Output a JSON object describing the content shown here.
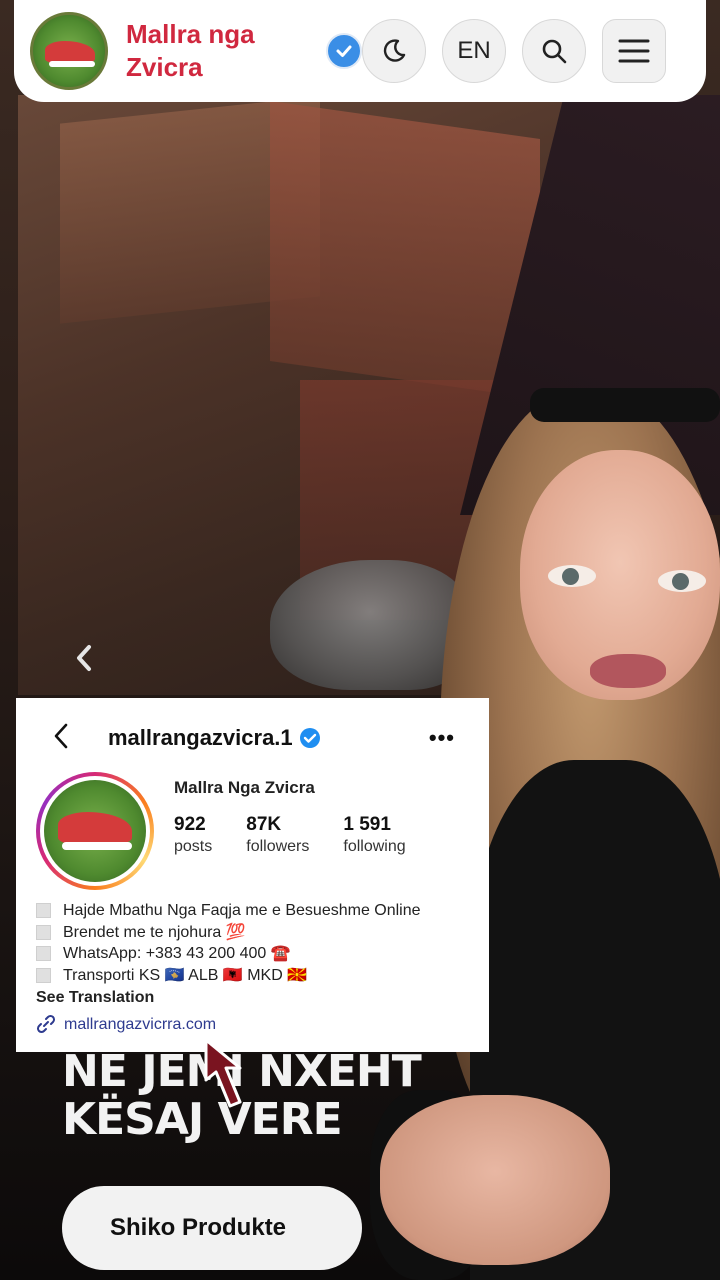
{
  "header": {
    "brand": "Mallra nga Zvicra",
    "brand_line1": "Mallra nga",
    "brand_line2": "Zvicra",
    "lang_label": "EN",
    "icons": [
      "verified-check-icon",
      "moon-icon",
      "search-icon",
      "menu-icon"
    ],
    "accent": "#d0283f"
  },
  "instagram": {
    "username": "mallrangazvicra.1",
    "display_name": "Mallra Nga Zvicra",
    "stats": [
      {
        "value": "922",
        "label": "posts"
      },
      {
        "value": "87K",
        "label": "followers"
      },
      {
        "value": "1 591",
        "label": "following"
      }
    ],
    "bio": [
      "Hajde Mbathu Nga Faqja me e Besueshme Online",
      "Brendet me te njohura 💯",
      "WhatsApp: +383 43 200 400 ☎️",
      "Transporti KS 🇽🇰 ALB 🇦🇱 MKD 🇲🇰"
    ],
    "see_translation": "See Translation",
    "link": "mallrangazvicrra.com",
    "more_glyph": "•••"
  },
  "promo": {
    "line1": "NE JEMI NXEHT",
    "line2": "KËSAJ VERE",
    "button": "Shiko Produkte"
  },
  "carousel": {
    "prev_glyph": "‹"
  }
}
